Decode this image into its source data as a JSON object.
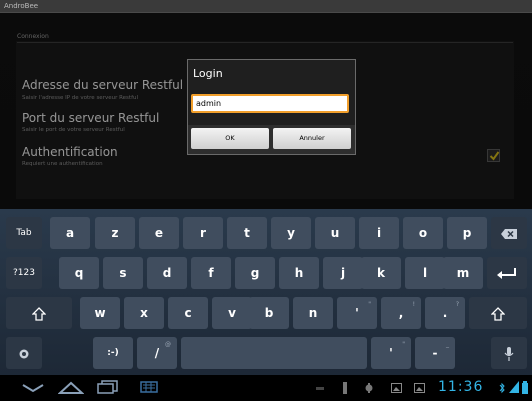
{
  "app": {
    "title": "AndroBee"
  },
  "settings": {
    "section_header": "Connexion",
    "items": [
      {
        "title": "Adresse du serveur Restful",
        "summary": "Saisir l'adresse IP de votre serveur Restful"
      },
      {
        "title": "Port du serveur Restful",
        "summary": "Saisir le port de votre serveur Restful"
      },
      {
        "title": "Authentification",
        "summary": "Requiert une authentification"
      }
    ],
    "auth_checked": true
  },
  "dialog": {
    "title": "Login",
    "input_value": "admin",
    "ok_label": "OK",
    "cancel_label": "Annuler"
  },
  "keyboard": {
    "row1": [
      "Tab",
      "a",
      "z",
      "e",
      "r",
      "t",
      "y",
      "u",
      "i",
      "o",
      "p"
    ],
    "row2": [
      "?123",
      "q",
      "s",
      "d",
      "f",
      "g",
      "h",
      "j",
      "k",
      "l",
      "m"
    ],
    "row3": [
      "w",
      "x",
      "c",
      "v",
      "b",
      "n",
      "'",
      ",",
      "."
    ],
    "row3_hints": [
      "",
      "",
      "",
      "",
      "",
      "",
      "\"",
      "!",
      "?"
    ],
    "row4": {
      "smiley": ":-)",
      "slash": "/",
      "slash_hint": "@",
      "apostrophe": "'",
      "apostrophe_hint": "\"",
      "dash": "-",
      "dash_hint": "_"
    }
  },
  "status": {
    "clock": "11:36"
  },
  "colors": {
    "accent": "#33b5e5",
    "input_focus": "#f19f2c",
    "check": "#c9b21b"
  }
}
